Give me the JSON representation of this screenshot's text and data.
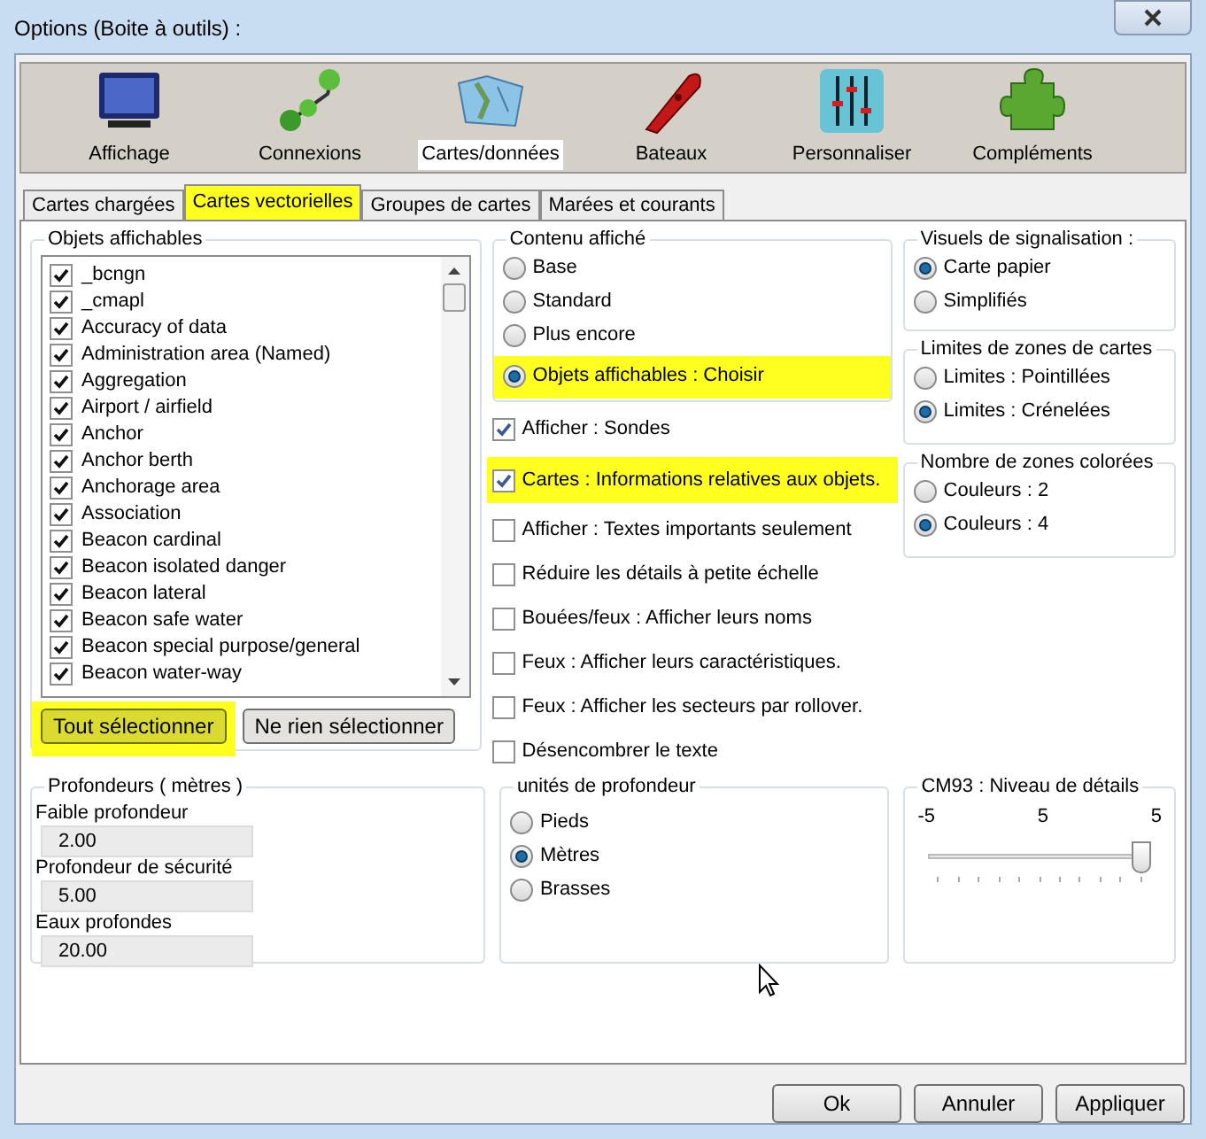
{
  "window": {
    "title": "Options (Boite à outils) :"
  },
  "toolbar": [
    {
      "label": "Affichage",
      "kind": "monitor",
      "selected": false
    },
    {
      "label": "Connexions",
      "kind": "network",
      "selected": false
    },
    {
      "label": "Cartes/données",
      "kind": "maps",
      "selected": true
    },
    {
      "label": "Bateaux",
      "kind": "boat",
      "selected": false
    },
    {
      "label": "Personnaliser",
      "kind": "sliders",
      "selected": false
    },
    {
      "label": "Compléments",
      "kind": "puzzle",
      "selected": false
    }
  ],
  "tabs": [
    {
      "label": "Cartes chargées",
      "selected": false,
      "highlighted": false
    },
    {
      "label": "Cartes vectorielles",
      "selected": true,
      "highlighted": true
    },
    {
      "label": "Groupes de cartes",
      "selected": false,
      "highlighted": false
    },
    {
      "label": "Marées et courants",
      "selected": false,
      "highlighted": false
    }
  ],
  "objects_panel": {
    "title": "Objets affichables",
    "items": [
      {
        "label": "_bcngn",
        "checked": true
      },
      {
        "label": "_cmapl",
        "checked": true
      },
      {
        "label": "Accuracy of data",
        "checked": true
      },
      {
        "label": "Administration area (Named)",
        "checked": true
      },
      {
        "label": "Aggregation",
        "checked": true
      },
      {
        "label": "Airport / airfield",
        "checked": true
      },
      {
        "label": "Anchor",
        "checked": true
      },
      {
        "label": "Anchor berth",
        "checked": true
      },
      {
        "label": "Anchorage area",
        "checked": true
      },
      {
        "label": "Association",
        "checked": true
      },
      {
        "label": "Beacon cardinal",
        "checked": true
      },
      {
        "label": "Beacon isolated danger",
        "checked": true
      },
      {
        "label": "Beacon lateral",
        "checked": true
      },
      {
        "label": "Beacon safe water",
        "checked": true
      },
      {
        "label": "Beacon special purpose/general",
        "checked": true
      },
      {
        "label": "Beacon water-way",
        "checked": true
      }
    ],
    "buttons": [
      {
        "label": "Tout sélectionner",
        "highlighted": true
      },
      {
        "label": "Ne rien sélectionner",
        "highlighted": false
      }
    ]
  },
  "content_group": {
    "title": "Contenu affiché",
    "options": [
      {
        "label": "Base",
        "selected": false,
        "highlighted": false
      },
      {
        "label": "Standard",
        "selected": false,
        "highlighted": false
      },
      {
        "label": "Plus encore",
        "selected": false,
        "highlighted": false
      },
      {
        "label": "Objets affichables : Choisir",
        "selected": true,
        "highlighted": true
      }
    ]
  },
  "display_checks": [
    {
      "label": "Afficher : Sondes",
      "checked": true,
      "highlighted": false
    },
    {
      "label": "Cartes : Informations relatives aux objets.",
      "checked": true,
      "highlighted": true
    },
    {
      "label": "Afficher : Textes importants seulement",
      "checked": false,
      "highlighted": false
    },
    {
      "label": "Réduire les détails à petite échelle",
      "checked": false,
      "highlighted": false
    },
    {
      "label": "Bouées/feux : Afficher leurs noms",
      "checked": false,
      "highlighted": false
    },
    {
      "label": "Feux : Afficher leurs caractéristiques.",
      "checked": false,
      "highlighted": false
    },
    {
      "label": "Feux : Afficher les secteurs par rollover.",
      "checked": false,
      "highlighted": false
    },
    {
      "label": "Désencombrer le texte",
      "checked": false,
      "highlighted": false
    }
  ],
  "signal_visuals": {
    "title": "Visuels de signalisation :",
    "options": [
      {
        "label": "Carte papier",
        "selected": true
      },
      {
        "label": "Simplifiés",
        "selected": false
      }
    ]
  },
  "chart_limits": {
    "title": "Limites de zones de cartes",
    "options": [
      {
        "label": "Limites : Pointillées",
        "selected": false
      },
      {
        "label": "Limites : Crénelées",
        "selected": true
      }
    ]
  },
  "color_zones": {
    "title": "Nombre de zones colorées",
    "options": [
      {
        "label": "Couleurs : 2",
        "selected": false
      },
      {
        "label": "Couleurs : 4",
        "selected": true
      }
    ]
  },
  "depths": {
    "title": "Profondeurs ( mètres )",
    "fields": [
      {
        "label": "Faible profondeur",
        "value": "2.00"
      },
      {
        "label": "Profondeur de sécurité",
        "value": "5.00"
      },
      {
        "label": "Eaux profondes",
        "value": "20.00"
      }
    ]
  },
  "depth_units": {
    "title": "unités de profondeur",
    "options": [
      {
        "label": "Pieds",
        "selected": false
      },
      {
        "label": "Mètres",
        "selected": true
      },
      {
        "label": "Brasses",
        "selected": false
      }
    ]
  },
  "cm93": {
    "title": "CM93 : Niveau de détails",
    "scale_labels": [
      "-5",
      "5",
      "5"
    ],
    "level": 1
  },
  "buttons": [
    "Ok",
    "Annuler",
    "Appliquer"
  ]
}
